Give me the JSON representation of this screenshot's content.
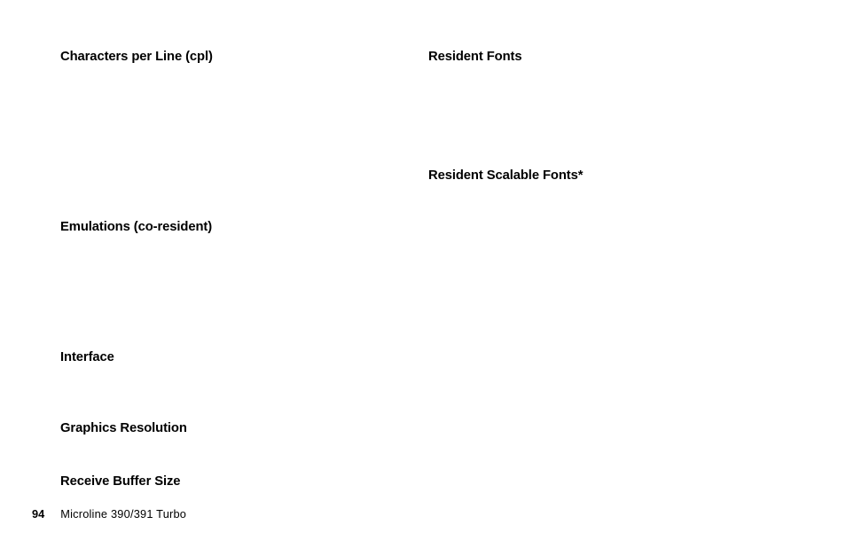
{
  "left": {
    "cpl": "Characters per Line (cpl)",
    "emulations": "Emulations (co-resident)",
    "interface": "Interface",
    "graphics": "Graphics Resolution",
    "buffer": "Receive Buffer Size"
  },
  "right": {
    "fonts": "Resident Fonts",
    "scalable": "Resident Scalable Fonts*"
  },
  "footer": {
    "page": "94",
    "title": "Microline 390/391 Turbo"
  }
}
